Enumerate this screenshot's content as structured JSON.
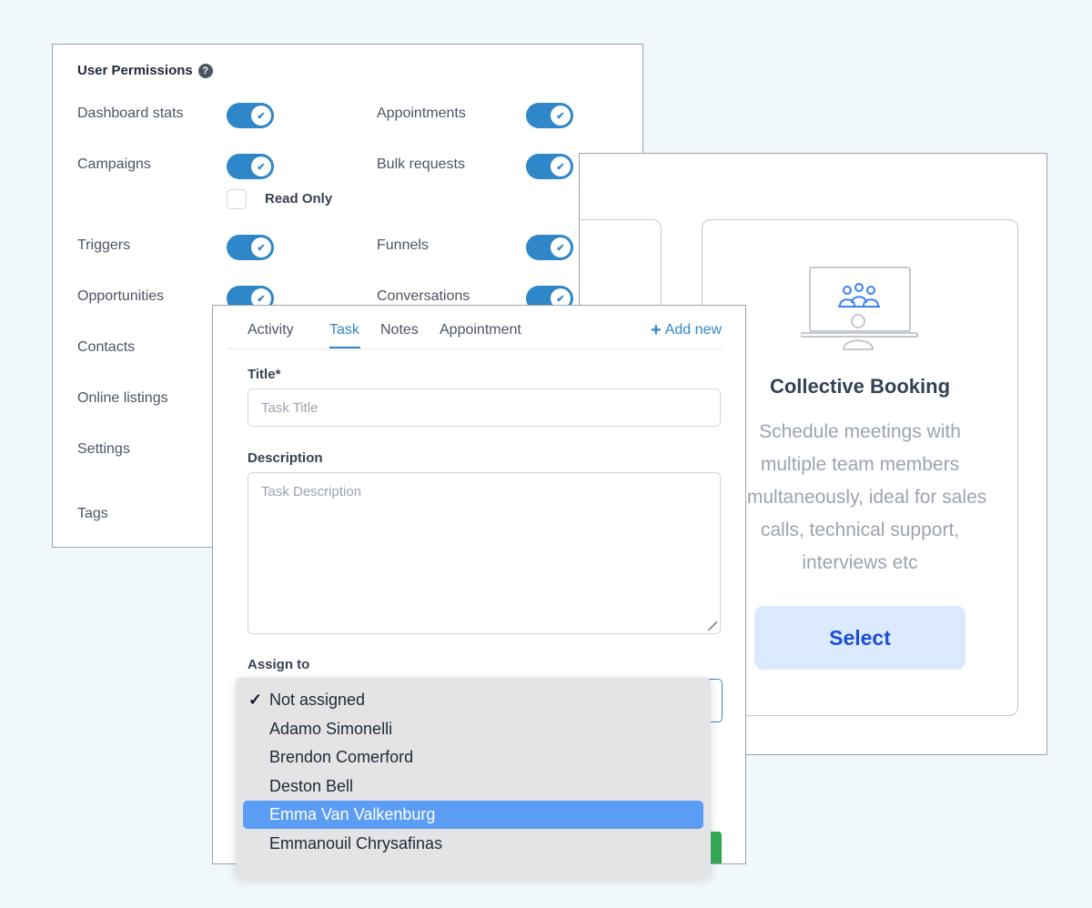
{
  "permissions": {
    "title": "User Permissions",
    "left": [
      {
        "label": "Dashboard stats",
        "enabled": true
      },
      {
        "label": "Campaigns",
        "enabled": true
      },
      {
        "label": "Triggers",
        "enabled": true
      },
      {
        "label": "Opportunities",
        "enabled": true
      },
      {
        "label": "Contacts"
      },
      {
        "label": "Online listings"
      },
      {
        "label": "Settings"
      },
      {
        "label": "Tags"
      }
    ],
    "right": [
      {
        "label": "Appointments",
        "enabled": true
      },
      {
        "label": "Bulk requests",
        "enabled": true
      },
      {
        "label": "Funnels",
        "enabled": true
      },
      {
        "label": "Conversations",
        "enabled": true
      }
    ],
    "read_only_label": "Read Only",
    "read_only_checked": false,
    "toggle_color": "#2f86c9"
  },
  "booking": {
    "title": "Collective Booking",
    "description": "Schedule meetings with multiple team members simultaneously, ideal for sales calls, technical support, interviews etc",
    "select_label": "Select",
    "accent": "#1d4ed8"
  },
  "task": {
    "tabs": [
      {
        "label": "Activity"
      },
      {
        "label": "Task",
        "active": true
      },
      {
        "label": "Notes"
      },
      {
        "label": "Appointment"
      }
    ],
    "add_new_label": "Add new",
    "title_label": "Title*",
    "title_placeholder": "Task Title",
    "description_label": "Description",
    "description_placeholder": "Task Description",
    "assign_label": "Assign to"
  },
  "assign_dropdown": {
    "options": [
      "Not assigned",
      "Adamo Simonelli",
      "Brendon Comerford",
      "Deston Bell",
      "Emma Van Valkenburg",
      "Emmanouil Chrysafinas"
    ],
    "checked": "Not assigned",
    "highlighted": "Emma Van Valkenburg"
  }
}
